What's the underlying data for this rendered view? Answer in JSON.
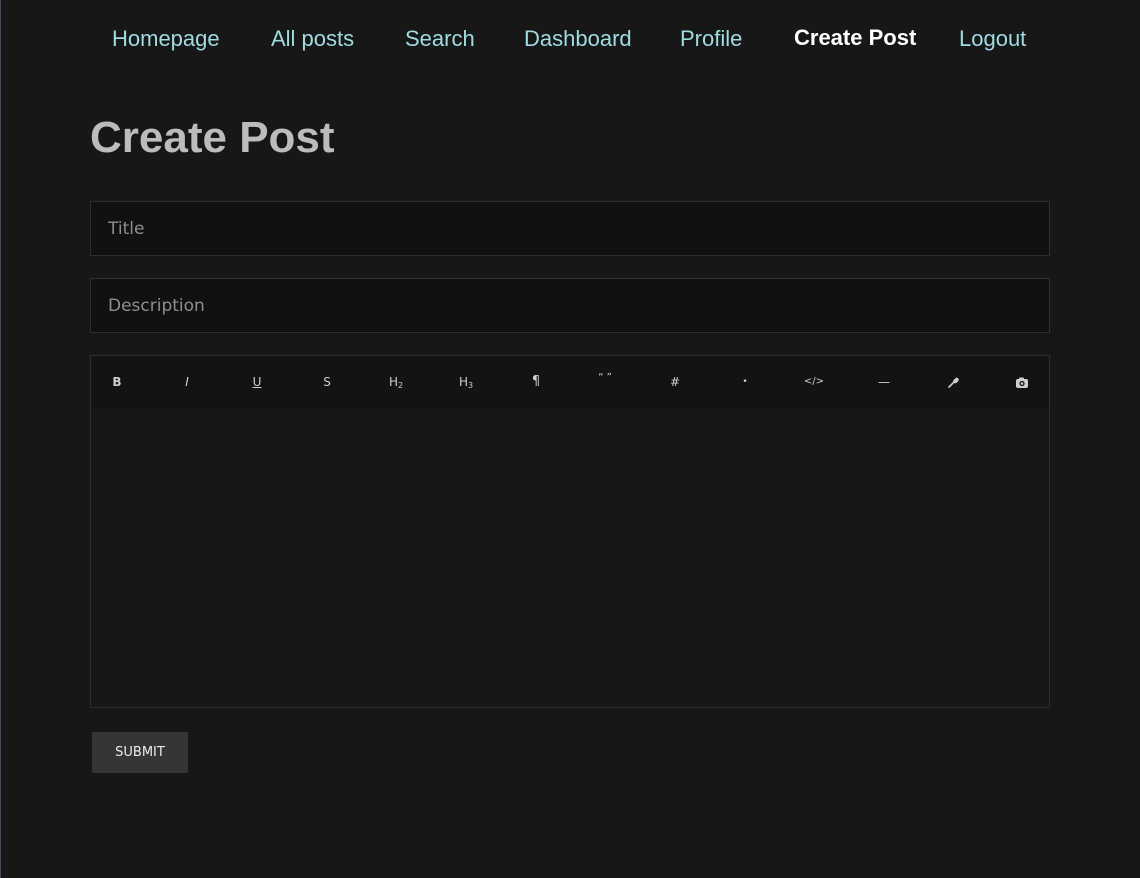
{
  "nav": {
    "items": [
      {
        "label": "Homepage"
      },
      {
        "label": "All posts"
      },
      {
        "label": "Search"
      },
      {
        "label": "Dashboard"
      },
      {
        "label": "Profile"
      },
      {
        "label": "Create Post",
        "active": true
      },
      {
        "label": "Logout"
      }
    ]
  },
  "page": {
    "title": "Create Post"
  },
  "form": {
    "title_placeholder": "Title",
    "title_value": "",
    "description_placeholder": "Description",
    "description_value": "",
    "submit_label": "SUBMIT"
  },
  "toolbar": {
    "bold": "B",
    "italic": "I",
    "underline": "U",
    "strike": "S",
    "h2": "H",
    "h2_level": "2",
    "h3": "H",
    "h3_level": "3",
    "paragraph": "¶",
    "quote": "“ ”",
    "ordered_list": "#",
    "bullet_list": "•",
    "code": "</>",
    "horizontal_rule": "—",
    "link_icon": "link-icon",
    "image_icon": "image-icon"
  },
  "colors": {
    "background": "#171717",
    "nav_link": "#9fdbe0",
    "nav_active": "#ffffff",
    "title": "#bcbcbc",
    "submit_bg": "#353535"
  }
}
